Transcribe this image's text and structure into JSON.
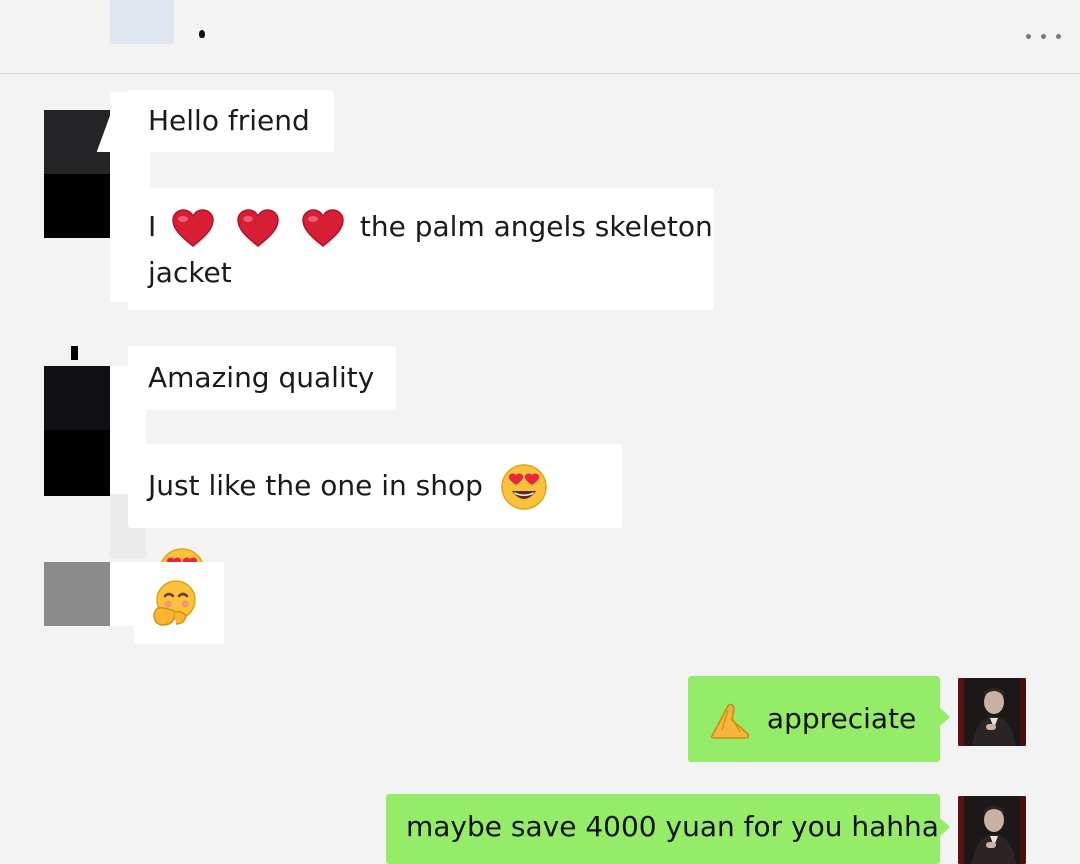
{
  "header": {
    "more_icon": "more-horizontal-icon"
  },
  "messages": [
    {
      "side": "in",
      "text": "Hello friend"
    },
    {
      "side": "in",
      "text_before": "I",
      "icons": [
        "red-heart-icon",
        "red-heart-icon",
        "red-heart-icon"
      ],
      "text_after": "the palm angels skeleton",
      "text_line2": "jacket"
    },
    {
      "side": "in",
      "text": "Amazing quality"
    },
    {
      "side": "in",
      "text": "Just like the one in shop",
      "icons": [
        "heart-eyes-emoji-icon",
        "heart-eyes-emoji-icon"
      ]
    },
    {
      "side": "in",
      "icons": [
        "shushing-face-emoji-icon"
      ]
    },
    {
      "side": "out",
      "icon": "folded-hands-emoji-icon",
      "text": "appreciate"
    },
    {
      "side": "out",
      "text": "maybe save 4000 yuan for you hahha"
    }
  ],
  "colors": {
    "background": "#f3f3f3",
    "incoming_bubble": "#ffffff",
    "outgoing_bubble": "#95ec69",
    "text": "#1b1b1b"
  }
}
